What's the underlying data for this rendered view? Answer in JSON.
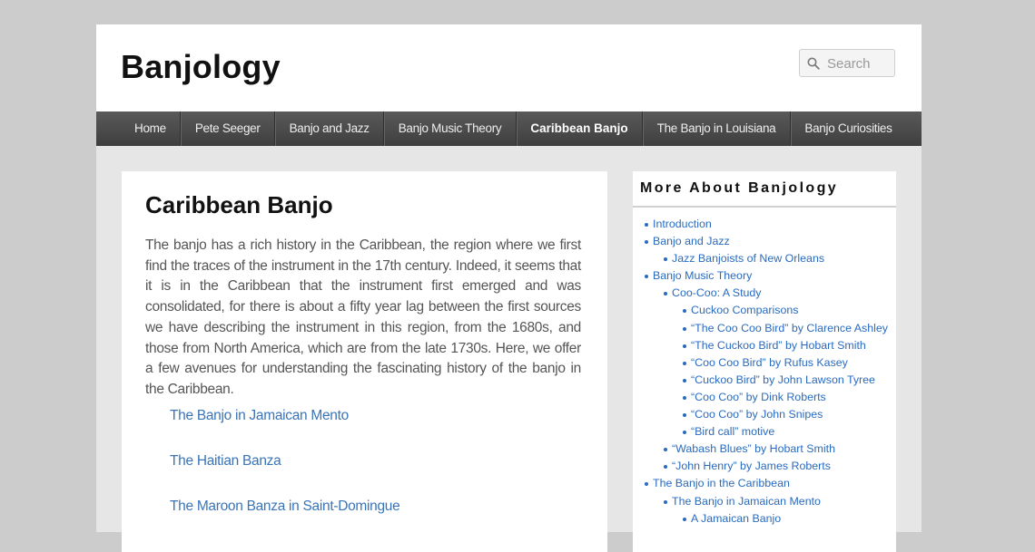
{
  "site": {
    "title": "Banjology"
  },
  "search": {
    "placeholder": "Search"
  },
  "nav": [
    {
      "label": "Home"
    },
    {
      "label": "Pete Seeger"
    },
    {
      "label": "Banjo and Jazz"
    },
    {
      "label": "Banjo Music Theory"
    },
    {
      "label": "Caribbean Banjo",
      "current": true
    },
    {
      "label": "The Banjo in Louisiana"
    },
    {
      "label": "Banjo Curiosities"
    }
  ],
  "main": {
    "title": "Caribbean Banjo",
    "body": "The banjo has a rich history in the Caribbean, the region where we first find the traces of the instrument in the 17th century. Indeed, it seems that it is in the Caribbean that the instrument first emerged and was consolidated, for there is about a fifty year lag between the first sources we have describing the instrument in this region, from the 1680s, and those from North America, which are from the late 1730s. Here, we offer a few avenues for understanding the fascinating history of the banjo in the Caribbean.",
    "links": [
      {
        "label": "The Banjo in Jamaican Mento"
      },
      {
        "label": "The Haitian Banza"
      },
      {
        "label": "The Maroon Banza in Saint-Domingue"
      }
    ]
  },
  "sidebar": {
    "title": "More About Banjology",
    "items": [
      {
        "label": "Introduction",
        "level": 0
      },
      {
        "label": "Banjo and Jazz",
        "level": 0
      },
      {
        "label": "Jazz Banjoists of New Orleans",
        "level": 1
      },
      {
        "label": "Banjo Music Theory",
        "level": 0
      },
      {
        "label": "Coo-Coo: A Study",
        "level": 1
      },
      {
        "label": "Cuckoo Comparisons",
        "level": 2
      },
      {
        "label": "“The Coo Coo Bird” by Clarence Ashley",
        "level": 2
      },
      {
        "label": "“The Cuckoo Bird” by Hobart Smith",
        "level": 2
      },
      {
        "label": "“Coo Coo Bird” by Rufus Kasey",
        "level": 2
      },
      {
        "label": "“Cuckoo Bird” by John Lawson Tyree",
        "level": 2
      },
      {
        "label": "“Coo Coo” by Dink Roberts",
        "level": 2
      },
      {
        "label": "“Coo Coo” by John Snipes",
        "level": 2
      },
      {
        "label": "“Bird call” motive",
        "level": 2
      },
      {
        "label": "“Wabash Blues” by Hobart Smith",
        "level": 1
      },
      {
        "label": "“John Henry” by James Roberts",
        "level": 1
      },
      {
        "label": "The Banjo in the Caribbean",
        "level": 0
      },
      {
        "label": "The Banjo in Jamaican Mento",
        "level": 1
      },
      {
        "label": "A Jamaican Banjo",
        "level": 2
      }
    ]
  }
}
